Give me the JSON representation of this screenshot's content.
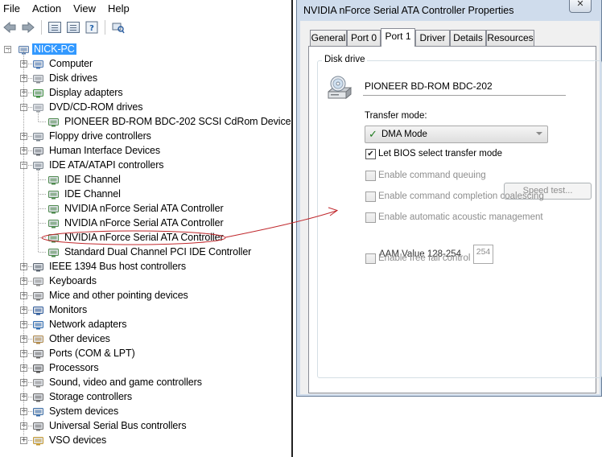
{
  "device_manager": {
    "menu": [
      "File",
      "Action",
      "View",
      "Help"
    ],
    "toolbar_icons": [
      "back-arrow-icon",
      "forward-arrow-icon",
      "console-tree-icon",
      "properties-icon",
      "help-icon",
      "scan-hardware-icon"
    ],
    "root": "NICK-PC",
    "tree": [
      {
        "label": "Computer",
        "icon": "computer-icon",
        "expanded": false
      },
      {
        "label": "Disk drives",
        "icon": "disk-drive-icon",
        "expanded": false
      },
      {
        "label": "Display adapters",
        "icon": "display-adapter-icon",
        "expanded": false
      },
      {
        "label": "DVD/CD-ROM drives",
        "icon": "optical-drive-icon",
        "expanded": true,
        "children": [
          "PIONEER BD-ROM  BDC-202 SCSI CdRom Device"
        ]
      },
      {
        "label": "Floppy drive controllers",
        "icon": "controller-icon",
        "expanded": false
      },
      {
        "label": "Human Interface Devices",
        "icon": "hid-icon",
        "expanded": false
      },
      {
        "label": "IDE ATA/ATAPI controllers",
        "icon": "controller-icon",
        "expanded": true,
        "children": [
          "IDE Channel",
          "IDE Channel",
          "NVIDIA nForce Serial ATA Controller",
          "NVIDIA nForce Serial ATA Controller",
          "NVIDIA nForce Serial ATA Controller",
          "Standard Dual Channel PCI IDE Controller"
        ]
      },
      {
        "label": "IEEE 1394 Bus host controllers",
        "icon": "firewire-icon",
        "expanded": false
      },
      {
        "label": "Keyboards",
        "icon": "keyboard-icon",
        "expanded": false
      },
      {
        "label": "Mice and other pointing devices",
        "icon": "mouse-icon",
        "expanded": false
      },
      {
        "label": "Monitors",
        "icon": "monitor-icon",
        "expanded": false
      },
      {
        "label": "Network adapters",
        "icon": "network-icon",
        "expanded": false
      },
      {
        "label": "Other devices",
        "icon": "other-device-icon",
        "expanded": false
      },
      {
        "label": "Ports (COM & LPT)",
        "icon": "port-icon",
        "expanded": false
      },
      {
        "label": "Processors",
        "icon": "processor-icon",
        "expanded": false
      },
      {
        "label": "Sound, video and game controllers",
        "icon": "sound-icon",
        "expanded": false
      },
      {
        "label": "Storage controllers",
        "icon": "storage-icon",
        "expanded": false
      },
      {
        "label": "System devices",
        "icon": "system-icon",
        "expanded": false
      },
      {
        "label": "Universal Serial Bus controllers",
        "icon": "usb-icon",
        "expanded": false
      },
      {
        "label": "VSO devices",
        "icon": "vso-icon",
        "expanded": false
      }
    ],
    "circled_item": "NVIDIA nForce Serial ATA Controller"
  },
  "dialog": {
    "title": "NVIDIA nForce Serial ATA Controller Properties",
    "tabs": [
      "General",
      "Port 0",
      "Port 1",
      "Driver",
      "Details",
      "Resources"
    ],
    "active_tab": "Port 1",
    "group_label": "Disk drive",
    "drive_name": "PIONEER BD-ROM  BDC-202",
    "transfer_mode_label": "Transfer mode:",
    "transfer_mode_value": "DMA Mode",
    "let_bios": {
      "label": "Let BIOS select transfer mode",
      "checked": true
    },
    "options": [
      {
        "label": "Enable command queuing",
        "checked": false,
        "enabled": false
      },
      {
        "label": "Enable command completion coalescing",
        "checked": false,
        "enabled": false
      },
      {
        "label": "Enable automatic acoustic management",
        "checked": false,
        "enabled": false
      },
      {
        "label": "Enable free fall control",
        "checked": false,
        "enabled": false
      }
    ],
    "speed_test_label": "Speed test...",
    "aam_label": "AAM Value 128-254",
    "aam_value": "254"
  },
  "colors": {
    "selection": "#3399ff",
    "annotation": "#c0282d",
    "dma_check": "#1e7b1e"
  }
}
